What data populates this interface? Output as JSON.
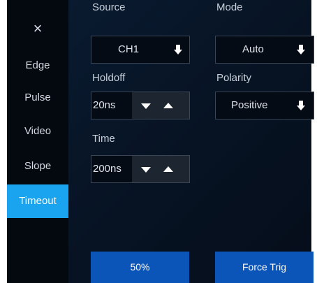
{
  "sidebar": {
    "close_label": "×",
    "items": [
      {
        "label": "Edge"
      },
      {
        "label": "Pulse"
      },
      {
        "label": "Video"
      },
      {
        "label": "Slope"
      },
      {
        "label": "Timeout"
      }
    ],
    "active_item": "Timeout"
  },
  "source": {
    "label": "Source",
    "value": "CH1"
  },
  "mode": {
    "label": "Mode",
    "value": "Auto"
  },
  "holdoff": {
    "label": "Holdoff",
    "value": "20ns"
  },
  "polarity": {
    "label": "Polarity",
    "value": "Positive"
  },
  "time": {
    "label": "Time",
    "value": "200ns"
  },
  "buttons": {
    "fifty_percent": "50%",
    "force_trig": "Force Trig"
  },
  "colors": {
    "panel_bg": "#071323",
    "sidebar_bg": "#04080f",
    "active_tab": "#1aa3ee",
    "action_button": "#0c55b8"
  }
}
